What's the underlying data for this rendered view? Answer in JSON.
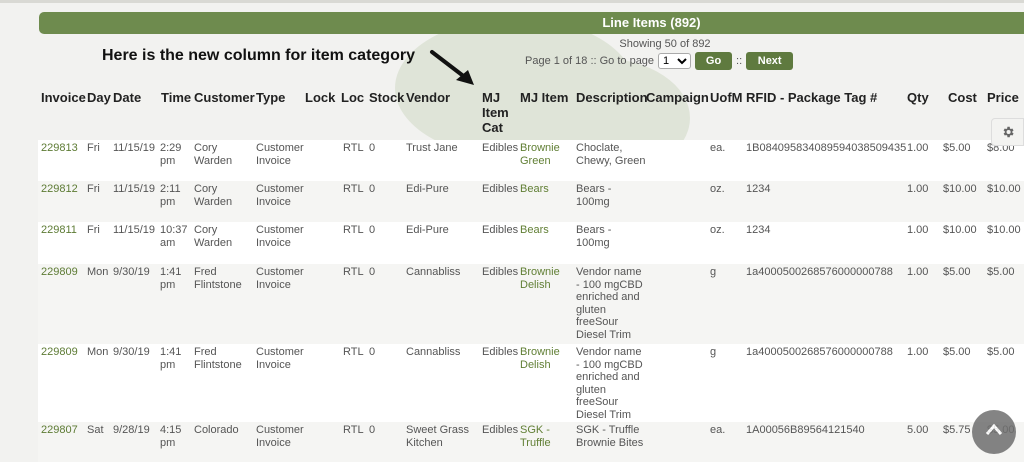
{
  "banner": {
    "title": "Line Items (892)"
  },
  "pagination": {
    "showing": "Showing 50 of 892",
    "page_text": "Page 1 of 18 :: Go to page",
    "page_value": "1",
    "go_label": "Go",
    "separator": "::",
    "next_label": "Next"
  },
  "annotation": {
    "text": "Here is the new column for item category"
  },
  "columns": {
    "invoice": "Invoice",
    "day": "Day",
    "date": "Date",
    "time": "Time",
    "customer": "Customer",
    "type": "Type",
    "lock": "Lock",
    "loc": "Loc",
    "stock": "Stock",
    "vendor": "Vendor",
    "mj_item_cat_1": "MJ",
    "mj_item_cat_2": "Item",
    "mj_item_cat_3": "Cat",
    "mj_item": "MJ Item",
    "description": "Description",
    "campaign": "Campaign",
    "uofm": "UofM",
    "rfid": "RFID - Package Tag #",
    "qty": "Qty",
    "cost": "Cost",
    "price": "Price"
  },
  "rows": [
    {
      "invoice": "229813",
      "day": "Fri",
      "date": "11/15/19",
      "time": [
        "2:29",
        "pm"
      ],
      "customer": [
        "Cory",
        "Warden"
      ],
      "type": [
        "Customer",
        "Invoice"
      ],
      "loc": "RTL",
      "stock": "0",
      "vendor": [
        "Trust Jane"
      ],
      "cat": "Edibles",
      "item": [
        "Brownie",
        "Green"
      ],
      "desc": [
        "Choclate,",
        "Chewy, Green"
      ],
      "uofm": "ea.",
      "rfid": "1B0840958340895940385094​35",
      "qty": "1.00",
      "cost": "$5.00",
      "price": "$8.00"
    },
    {
      "invoice": "229812",
      "day": "Fri",
      "date": "11/15/19",
      "time": [
        "2:11",
        "pm"
      ],
      "customer": [
        "Cory",
        "Warden"
      ],
      "type": [
        "Customer",
        "Invoice"
      ],
      "loc": "RTL",
      "stock": "0",
      "vendor": [
        "Edi-Pure"
      ],
      "cat": "Edibles",
      "item": [
        "Bears"
      ],
      "desc": [
        "Bears -",
        "100mg"
      ],
      "uofm": "oz.",
      "rfid": "1234",
      "qty": "1.00",
      "cost": "$10.00",
      "price": "$10.00"
    },
    {
      "invoice": "229811",
      "day": "Fri",
      "date": "11/15/19",
      "time": [
        "10:37",
        "am"
      ],
      "customer": [
        "Cory",
        "Warden"
      ],
      "type": [
        "Customer",
        "Invoice"
      ],
      "loc": "RTL",
      "stock": "0",
      "vendor": [
        "Edi-Pure"
      ],
      "cat": "Edibles",
      "item": [
        "Bears"
      ],
      "desc": [
        "Bears -",
        "100mg"
      ],
      "uofm": "oz.",
      "rfid": "1234",
      "qty": "1.00",
      "cost": "$10.00",
      "price": "$10.00"
    },
    {
      "invoice": "229809",
      "day": "Mon",
      "date": "9/30/19",
      "time": [
        "1:41",
        "pm"
      ],
      "customer": [
        "Fred",
        "Flintstone"
      ],
      "type": [
        "Customer",
        "Invoice"
      ],
      "loc": "RTL",
      "stock": "0",
      "vendor": [
        "Cannabliss"
      ],
      "cat": "Edibles",
      "item": [
        "Brownie",
        "Delish"
      ],
      "desc": [
        "Vendor name",
        "- 100 mgCBD",
        "enriched and",
        "gluten",
        "freeSour",
        "Diesel Trim"
      ],
      "uofm": "g",
      "rfid": "1a4000500268576000000788",
      "qty": "1.00",
      "cost": "$5.00",
      "price": "$5.00"
    },
    {
      "invoice": "229809",
      "day": "Mon",
      "date": "9/30/19",
      "time": [
        "1:41",
        "pm"
      ],
      "customer": [
        "Fred",
        "Flintstone"
      ],
      "type": [
        "Customer",
        "Invoice"
      ],
      "loc": "RTL",
      "stock": "0",
      "vendor": [
        "Cannabliss"
      ],
      "cat": "Edibles",
      "item": [
        "Brownie",
        "Delish"
      ],
      "desc": [
        "Vendor name",
        "- 100 mgCBD",
        "enriched and",
        "gluten",
        "freeSour",
        "Diesel Trim"
      ],
      "uofm": "g",
      "rfid": "1a4000500268576000000788",
      "qty": "1.00",
      "cost": "$5.00",
      "price": "$5.00"
    },
    {
      "invoice": "229807",
      "day": "Sat",
      "date": "9/28/19",
      "time": [
        "4:15",
        "pm"
      ],
      "customer": [
        "Colorado"
      ],
      "type": [
        "Customer",
        "Invoice"
      ],
      "loc": "RTL",
      "stock": "0",
      "vendor": [
        "Sweet Grass",
        "Kitchen"
      ],
      "cat": "Edibles",
      "item": [
        "SGK -",
        "Truffle"
      ],
      "desc": [
        "SGK - Truffle",
        "Brownie Bites"
      ],
      "uofm": "ea.",
      "rfid": "1A00056B89564121540",
      "qty": "5.00",
      "cost": "$5.75",
      "price": "$5.00"
    }
  ],
  "icons": {
    "settings": "gear-icon",
    "scroll_top": "chevron-up-icon",
    "annotation_arrow": "arrow-icon"
  },
  "colors": {
    "accent": "#6e8b4e",
    "link": "#617f35"
  }
}
